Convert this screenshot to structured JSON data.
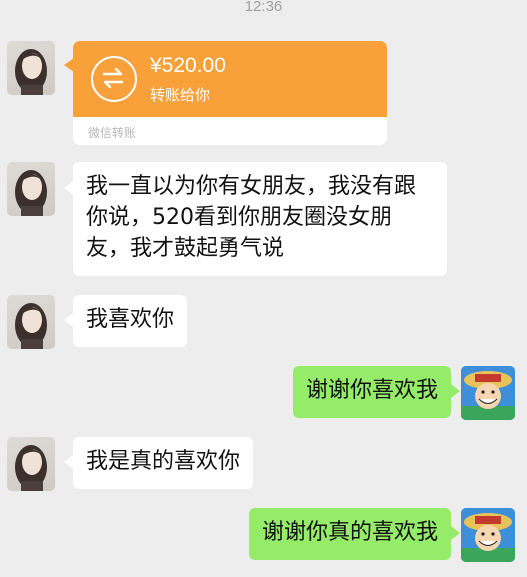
{
  "status_time": "12:36",
  "colors": {
    "background": "#ededed",
    "transfer_orange": "#f8a03a",
    "self_bubble": "#95ec69",
    "other_bubble": "#ffffff"
  },
  "transfer": {
    "amount": "¥520.00",
    "description": "转账给你",
    "footer": "微信转账",
    "icon": "transfer-arrows-icon"
  },
  "messages": [
    {
      "sender": "other",
      "text": "我一直以为你有女朋友，我没有跟你说，520看到你朋友圈没女朋友，我才鼓起勇气说"
    },
    {
      "sender": "other",
      "text": "我喜欢你"
    },
    {
      "sender": "self",
      "text": "谢谢你喜欢我"
    },
    {
      "sender": "other",
      "text": "我是真的喜欢你"
    },
    {
      "sender": "self",
      "text": "谢谢你真的喜欢我"
    }
  ]
}
